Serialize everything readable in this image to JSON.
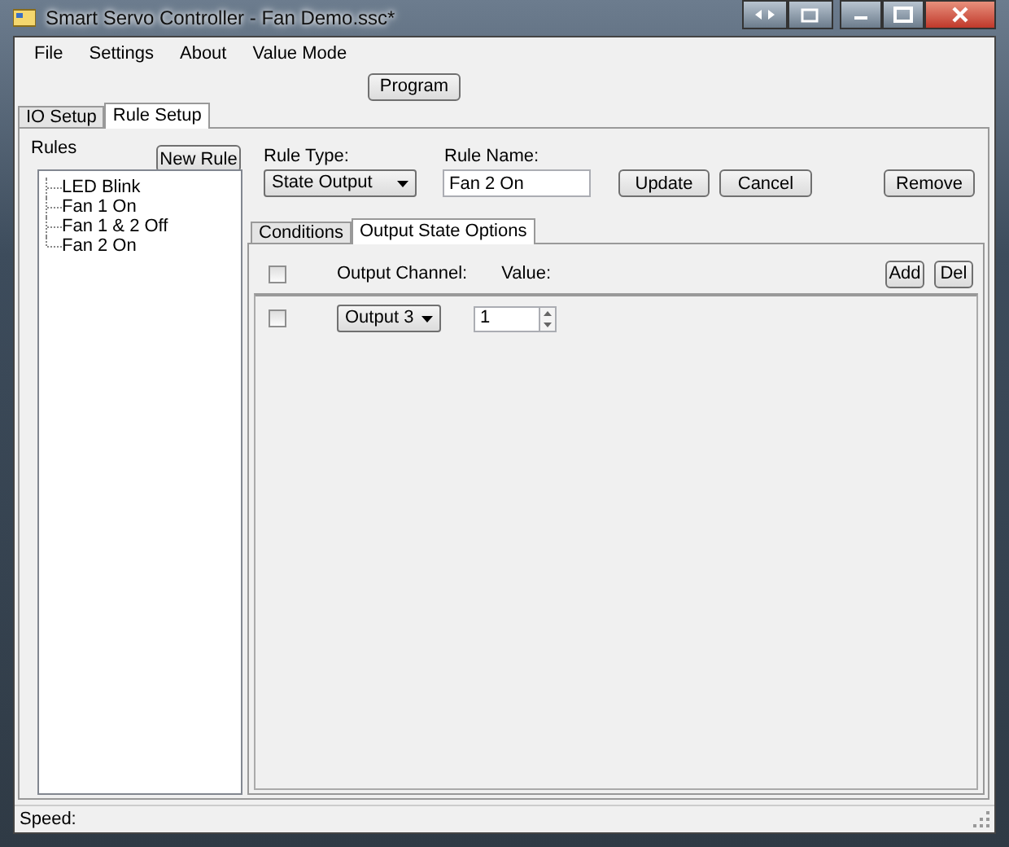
{
  "window": {
    "title": "Smart Servo Controller - Fan Demo.ssc*"
  },
  "menu": [
    "File",
    "Settings",
    "About",
    "Value Mode"
  ],
  "toolbar": {
    "program_button": "Program"
  },
  "tabs": [
    {
      "label": "IO Setup",
      "selected": false
    },
    {
      "label": "Rule Setup",
      "selected": true
    }
  ],
  "rules_panel": {
    "title": "Rules",
    "new_button": "New Rule",
    "items": [
      {
        "label": "LED Blink"
      },
      {
        "label": "Fan 1 On"
      },
      {
        "label": "Fan 1 & 2 Off"
      },
      {
        "label": "Fan 2 On"
      }
    ]
  },
  "rule_form": {
    "type_label": "Rule Type:",
    "type_value": "State Output",
    "name_label": "Rule Name:",
    "name_value": "Fan 2 On",
    "buttons": [
      "Update",
      "Cancel",
      "Remove"
    ]
  },
  "sub_tabs": [
    {
      "label": "Conditions",
      "selected": false
    },
    {
      "label": "Output State Options",
      "selected": true
    }
  ],
  "outputs": {
    "header": {
      "checked": false,
      "channel_label": "Output Channel:",
      "value_label": "Value:",
      "buttons": [
        "Add",
        "Del"
      ]
    },
    "rows": [
      {
        "checked": false,
        "channel": "Output 3",
        "value": "1"
      }
    ]
  },
  "status_bar": {
    "label": "Speed:"
  }
}
